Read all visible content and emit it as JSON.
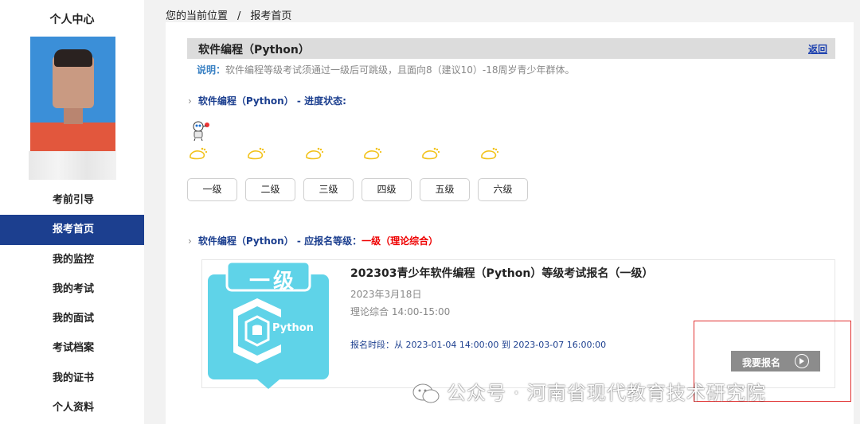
{
  "sidebar": {
    "title": "个人中心",
    "nav": [
      {
        "label": "考前引导",
        "active": false
      },
      {
        "label": "报考首页",
        "active": true
      },
      {
        "label": "我的监控",
        "active": false
      },
      {
        "label": "我的考试",
        "active": false
      },
      {
        "label": "我的面试",
        "active": false
      },
      {
        "label": "考试档案",
        "active": false
      },
      {
        "label": "我的证书",
        "active": false
      },
      {
        "label": "个人资料",
        "active": false
      }
    ]
  },
  "breadcrumb": {
    "prefix": "您的当前位置",
    "separator": "/",
    "current": "报考首页"
  },
  "section": {
    "title": "软件编程（Python）",
    "back_label": "返回",
    "desc_label": "说明：",
    "desc_text": "软件编程等级考试须通过一级后可跳级，且面向8（建议10）-18周岁青少年群体。"
  },
  "progress": {
    "heading_prefix": "软件编程（Python）",
    "heading_suffix": " - 进度状态:",
    "levels": [
      "一级",
      "二级",
      "三级",
      "四级",
      "五级",
      "六级"
    ]
  },
  "enroll_level": {
    "heading_prefix": "软件编程（Python）",
    "heading_middle": " - 应报名等级：",
    "level_value": "一级（理论综合）"
  },
  "exam": {
    "badge_level": "一级",
    "badge_text": "Python",
    "title": "202303青少年软件编程（Python）等级考试报名（一级）",
    "date": "2023年3月18日",
    "time": "理论综合 14:00-15:00",
    "period": "报名时段：从 2023-01-04 14:00:00 到 2023-03-07 16:00:00",
    "enroll_label": "我要报名"
  },
  "watermark": {
    "text": "公众号 · 河南省现代教育技术研究院"
  },
  "colors": {
    "nav_active": "#1c3f8f",
    "link_blue": "#1a3fae",
    "alert_red": "#e00000",
    "badge_cyan": "#5fd3e8",
    "foot_yellow": "#f2c21a"
  }
}
